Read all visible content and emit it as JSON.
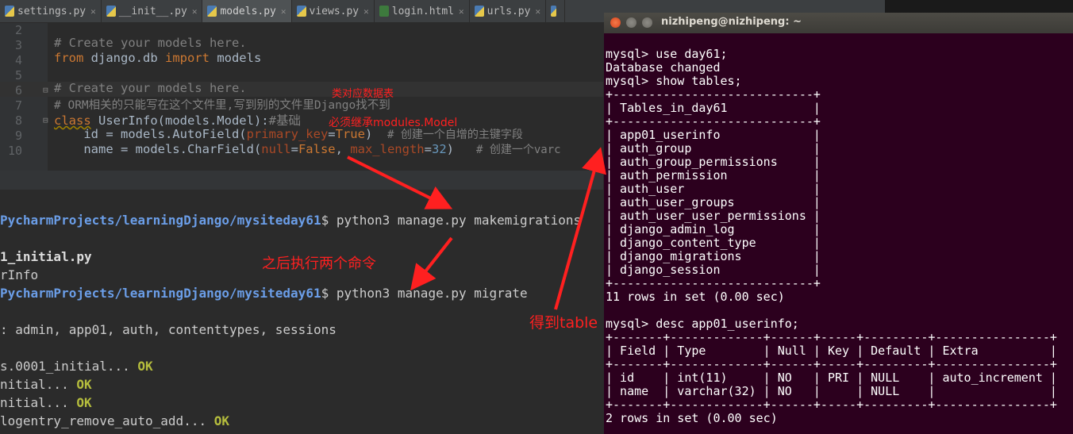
{
  "tabs": [
    {
      "label": "settings.py",
      "icon": "python-file-icon",
      "active": false
    },
    {
      "label": "__init__.py",
      "icon": "python-file-icon",
      "active": false
    },
    {
      "label": "models.py",
      "icon": "python-file-icon",
      "active": true
    },
    {
      "label": "views.py",
      "icon": "python-file-icon",
      "active": false
    },
    {
      "label": "login.html",
      "icon": "html-file-icon",
      "active": false
    },
    {
      "label": "urls.py",
      "icon": "python-file-icon",
      "active": false
    }
  ],
  "editor": {
    "line_numbers": [
      "2",
      "3",
      "4",
      "5",
      "6",
      "7",
      "8",
      "9",
      "10"
    ],
    "lines": {
      "l2": "# Create your models here.",
      "l3_kw1": "from",
      "l3_mid": " django.db ",
      "l3_kw2": "import",
      "l3_end": " models",
      "l5": "# Create your models here.",
      "l6": "# ORM相关的只能写在这个文件里,写到别的文件里Django找不到",
      "l7_kw": "class",
      "l7_rest": " UserInfo(models.Model):",
      "l7_comment": "#基础",
      "l8_a": "    id = models.AutoField(",
      "l8_param": "primary_key",
      "l8_eq": "=",
      "l8_val": "True",
      "l8_b": ")  ",
      "l8_comment": "# 创建一个自增的主键字段",
      "l9_a": "    name = models.CharField(",
      "l9_p1": "null",
      "l9_eq1": "=",
      "l9_v1": "False",
      "l9_comma": ", ",
      "l9_p2": "max_length",
      "l9_eq2": "=",
      "l9_v2": "32",
      "l9_b": ")   ",
      "l9_comment": "# 创建一个varc"
    }
  },
  "terminal": {
    "path1": "PycharmProjects/learningDjango/mysiteday61",
    "cmd1": "$ python3 manage.py makemigrations",
    "out1": "1_initial.py",
    "out2": "rInfo",
    "path2": "PycharmProjects/learningDjango/mysiteday61",
    "cmd2": "$ python3 manage.py migrate",
    "out3": ": admin, app01, auth, contenttypes, sessions",
    "mig1": "s.0001_initial... ",
    "mig2": "nitial... ",
    "mig3": "nitial... ",
    "mig4": "logentry_remove_auto_add... ",
    "ok": "OK"
  },
  "annotations": {
    "table_note": "类对应数据表",
    "inherit_note": "必须继承modules.Model",
    "then_note": "之后执行两个命令",
    "get_note": "得到table"
  },
  "mysql": {
    "title": "nizhipeng@nizhipeng: ~",
    "lines": [
      "mysql> use day61;",
      "Database changed",
      "mysql> show tables;",
      "+----------------------------+",
      "| Tables_in_day61            |",
      "+----------------------------+",
      "| app01_userinfo             |",
      "| auth_group                 |",
      "| auth_group_permissions     |",
      "| auth_permission            |",
      "| auth_user                  |",
      "| auth_user_groups           |",
      "| auth_user_user_permissions |",
      "| django_admin_log           |",
      "| django_content_type        |",
      "| django_migrations          |",
      "| django_session             |",
      "+----------------------------+",
      "11 rows in set (0.00 sec)",
      "",
      "mysql> desc app01_userinfo;",
      "+-------+-------------+------+-----+---------+----------------+",
      "| Field | Type        | Null | Key | Default | Extra          |",
      "+-------+-------------+------+-----+---------+----------------+",
      "| id    | int(11)     | NO   | PRI | NULL    | auto_increment |",
      "| name  | varchar(32) | NO   |     | NULL    |                |",
      "+-------+-------------+------+-----+---------+----------------+",
      "2 rows in set (0.00 sec)"
    ]
  },
  "colors": {
    "accent_annotation": "#ff2020",
    "ubuntu_terminal_bg": "#2c001e",
    "ok_text": "#b5bd3d"
  }
}
